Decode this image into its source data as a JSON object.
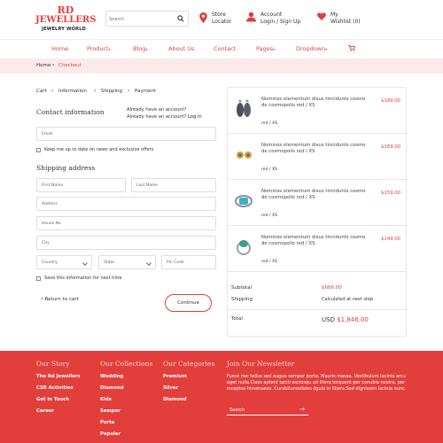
{
  "brand": {
    "line1": "RD",
    "line2": "JEWELLERS",
    "line3": "JEWELRY WORLD"
  },
  "header": {
    "search_placeholder": "Search",
    "store_locator": [
      "Store",
      "Locator"
    ],
    "account": [
      "Account",
      "Login / Sign Up"
    ],
    "wishlist": [
      "My",
      "Wishlist (0)"
    ]
  },
  "nav": {
    "items": [
      "Home",
      "Product",
      "Blog",
      "About Us",
      "Contact",
      "Pages",
      "Dropdown"
    ]
  },
  "breadcrumb": {
    "home": "Home",
    "current": "Checkout"
  },
  "steps": [
    "Cart",
    "Information",
    "Shipping",
    "Payment"
  ],
  "contact": {
    "title": "Contact information",
    "have_account": "Already have an account?",
    "have_account_login": "Already have an account?",
    "login_link": "Log in",
    "email_placeholder": "Email",
    "newsletter_label": "Keep me up to date on news and exclusive offers"
  },
  "shipping": {
    "title": "Shipping address",
    "first_name": "First Name",
    "last_name": "Last Name",
    "address": "Address",
    "house": "House No",
    "city": "City",
    "country": "Country",
    "state": "State",
    "pin": "Pin Code",
    "save_label": "Save this information for next time",
    "return_label": "Return to cart",
    "continue_label": "Continue"
  },
  "order": {
    "items": [
      {
        "name": "Nominos elementum disus tincidunts cosmo de cosmopolis red / XS",
        "price": "$189.00",
        "variant": "red / XS"
      },
      {
        "name": "Nominos elementum disus tincidunts cosmo de cosmopolis red / XS",
        "price": "$169.00",
        "variant": "red / XS"
      },
      {
        "name": "Nominos elementum disus tincidunts cosmo de cosmopolis red / XS",
        "price": "$159.00",
        "variant": "red / XS"
      },
      {
        "name": "Nominos elementum disus tincidunts cosmo de cosmopolis red / XS",
        "price": "$149.00",
        "variant": "red / XS"
      }
    ],
    "subtotal_label": "Subtotal",
    "subtotal_value": "$666.00",
    "shipping_label": "Shipping",
    "shipping_value": "Calculated at next step",
    "total_label": "Total",
    "total_currency": "USD",
    "total_value": "$1,846.00"
  },
  "footer": {
    "our_story": {
      "title": "Our Story",
      "links": [
        "The Rd Jewellers",
        "CSR Activities",
        "Get in Touch",
        "Career"
      ]
    },
    "collections": {
      "title": "Our Collections",
      "links": [
        "Wedding",
        "Diamond",
        "Kids",
        "Semper",
        "Porta",
        "Popular"
      ]
    },
    "categories": {
      "title": "Our Categories",
      "links": [
        "Premium",
        "Silver",
        "Diamond"
      ]
    },
    "newsletter": {
      "title": "Join Our Newsletter",
      "text": "Fusce nec tellus sed augue semper porta. Mauris massa. Vestibulum lacinia arcu eget nulla.Class aptent taciti sociosqu ad litora torquent per conubia nostra, per inceptos himenaeos. Curabitursodales ligula in libero.Sed dignissim lacinia nunc.",
      "search_placeholder": "Search"
    }
  },
  "colors": {
    "accent": "#e23f3c",
    "breadcrumb_bg": "#fbeaea"
  }
}
